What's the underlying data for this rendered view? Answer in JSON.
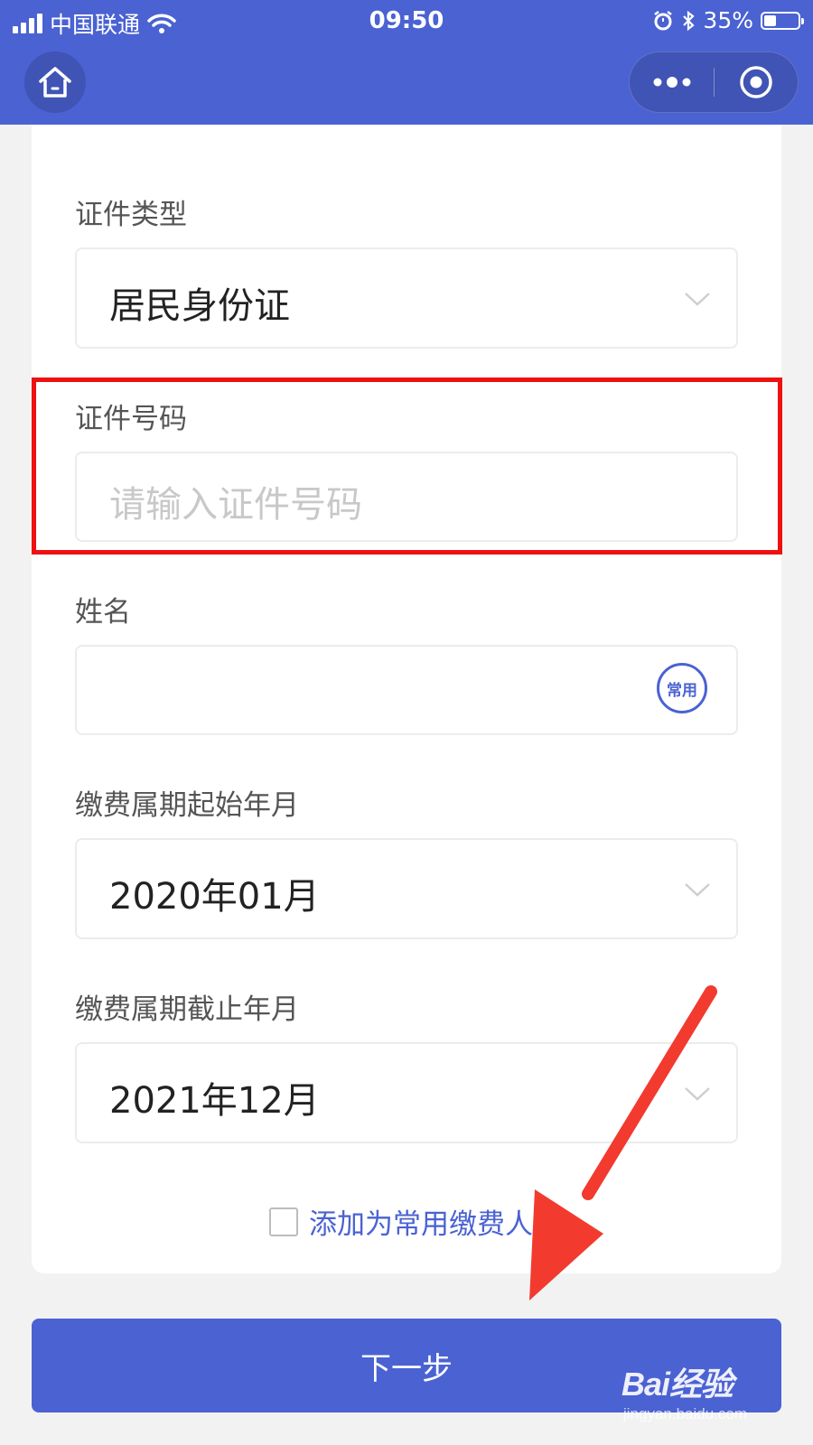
{
  "status_bar": {
    "carrier": "中国联通",
    "time": "09:50",
    "battery": "35%",
    "battery_level": 0.35
  },
  "form": {
    "id_type": {
      "label": "证件类型",
      "value": "居民身份证"
    },
    "id_number": {
      "label": "证件号码",
      "placeholder": "请输入证件号码",
      "value": ""
    },
    "name": {
      "label": "姓名",
      "value": "",
      "common_badge": "常用"
    },
    "start_period": {
      "label": "缴费属期起始年月",
      "value": "2020年01月"
    },
    "end_period": {
      "label": "缴费属期截止年月",
      "value": "2021年12月"
    },
    "add_common": {
      "label": "添加为常用缴费人",
      "checked": false
    }
  },
  "next_button": {
    "label": "下一步"
  },
  "watermark": {
    "main": "Bai经验",
    "sub": "jingyan.baidu.com"
  },
  "colors": {
    "brand": "#4a62d2",
    "highlight": "#ee1111",
    "arrow": "#f23a2f"
  },
  "icons": {
    "home": "home-icon",
    "more": "more-dots-icon",
    "close": "target-circle-icon",
    "dropdown": "chevron-down-icon"
  }
}
